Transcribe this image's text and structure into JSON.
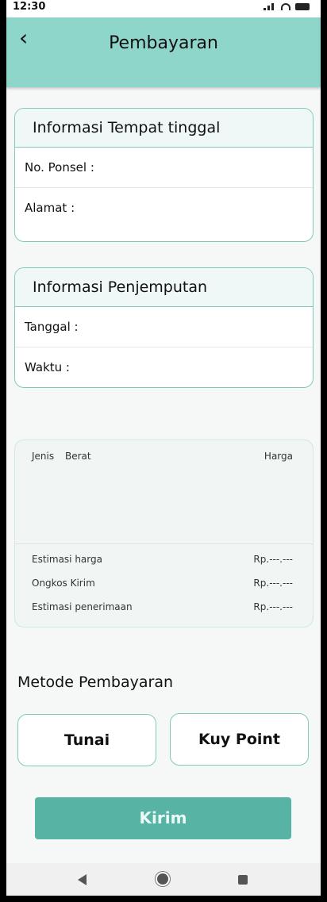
{
  "status_bar": {
    "time": "12:30"
  },
  "header": {
    "title": "Pembayaran"
  },
  "residence": {
    "title": "Informasi Tempat tinggal",
    "phone_label": "No. Ponsel :",
    "address_label": "Alamat :"
  },
  "pickup": {
    "title": "Informasi Penjemputan",
    "date_label": "Tanggal :",
    "time_label": "Waktu :"
  },
  "summary": {
    "col_type": "Jenis",
    "col_weight": "Berat",
    "col_price": "Harga",
    "rows": [
      {
        "label": "Estimasi harga",
        "value": "Rp.---.---"
      },
      {
        "label": "Ongkos Kirim",
        "value": "Rp.---.---"
      },
      {
        "label": "Estimasi penerimaan",
        "value": "Rp.---.---"
      }
    ]
  },
  "payment": {
    "title": "Metode Pembayaran",
    "option_cash": "Tunai",
    "option_point": "Kuy Point"
  },
  "submit": {
    "label": "Kirim"
  },
  "colors": {
    "accent": "#8dd6c9",
    "button": "#57b3a4",
    "border": "#7ecbbd"
  },
  "icons": {
    "back": "back-arrow-icon",
    "nav_back": "nav-back-icon",
    "nav_home": "nav-home-icon",
    "nav_recent": "nav-recent-icon"
  }
}
